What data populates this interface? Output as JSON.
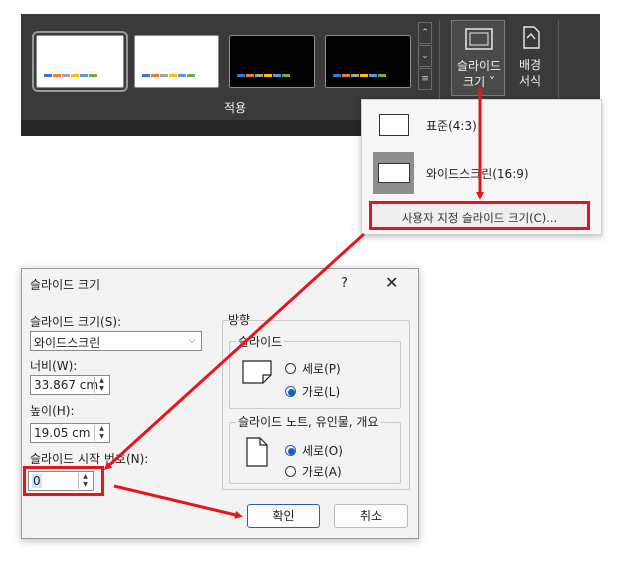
{
  "ribbon": {
    "thumbnails": [
      {
        "theme": "white",
        "selected": true
      },
      {
        "theme": "white",
        "selected": false
      },
      {
        "theme": "black",
        "selected": false
      },
      {
        "theme": "black",
        "selected": false
      }
    ],
    "apply_label": "적용",
    "slide_size_label_line1": "슬라이드",
    "slide_size_label_line2": "크기 ˅",
    "background_label_line1": "배경",
    "background_label_line2": "서식",
    "bar_colors": [
      "#4472c4",
      "#ed7d31",
      "#a5a5a5",
      "#ffc000",
      "#5b9bd5",
      "#70ad47"
    ]
  },
  "menu": {
    "standard_label": "표준(4:3)",
    "widescreen_label": "와이드스크린(16:9)",
    "custom_label": "사용자 지정 슬라이드 크기(C)..."
  },
  "dialog": {
    "title": "슬라이드 크기",
    "help": "?",
    "close": "✕",
    "slide_size_label": "슬라이드 크기(S):",
    "slide_size_value": "와이드스크린",
    "width_label": "너비(W):",
    "width_value": "33.867 cm",
    "height_label": "높이(H):",
    "height_value": "19.05 cm",
    "start_number_label": "슬라이드 시작 번호(N):",
    "start_number_value": "0",
    "orientation_label": "방향",
    "slides_group_label": "슬라이드",
    "slides_portrait": "세로(P)",
    "slides_landscape": "가로(L)",
    "slides_selected": "landscape",
    "notes_group_label": "슬라이드 노트, 유인물, 개요",
    "notes_portrait": "세로(O)",
    "notes_landscape": "가로(A)",
    "notes_selected": "portrait",
    "ok_label": "확인",
    "cancel_label": "취소"
  },
  "colors": {
    "annotation_red": "#e8141b",
    "accent_blue": "#1f5fb4",
    "ribbon_dark": "#3a3a3a"
  }
}
